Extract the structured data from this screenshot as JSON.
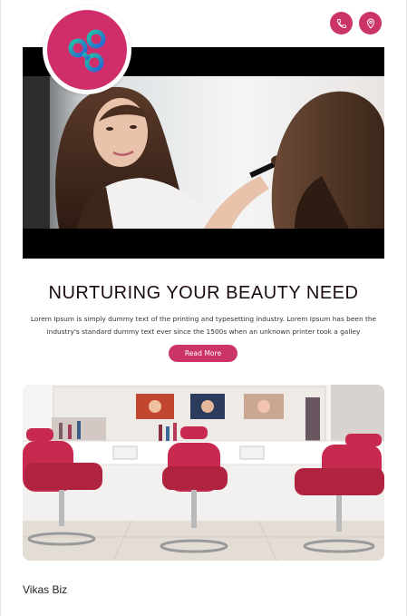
{
  "header": {
    "phone_icon": "phone-icon",
    "location_icon": "location-pin-icon"
  },
  "logo": {
    "icon": "infinity-link-logo",
    "brand_color": "#d02e6b",
    "accent_color": "#1fc6a5"
  },
  "hero": {
    "title": "NURTURING YOUR BEAUTY NEED",
    "description": "Lorem Ipsum is simply dummy text of the printing and typesetting industry. Lorem Ipsum has been the industry's standard dummy text ever since the 1500s when an unknown printer took a galley",
    "read_more_label": "Read More"
  },
  "footer": {
    "brand": "Vikas Biz"
  },
  "colors": {
    "accent": "#cc3366",
    "dark_text": "#1a0a12"
  }
}
